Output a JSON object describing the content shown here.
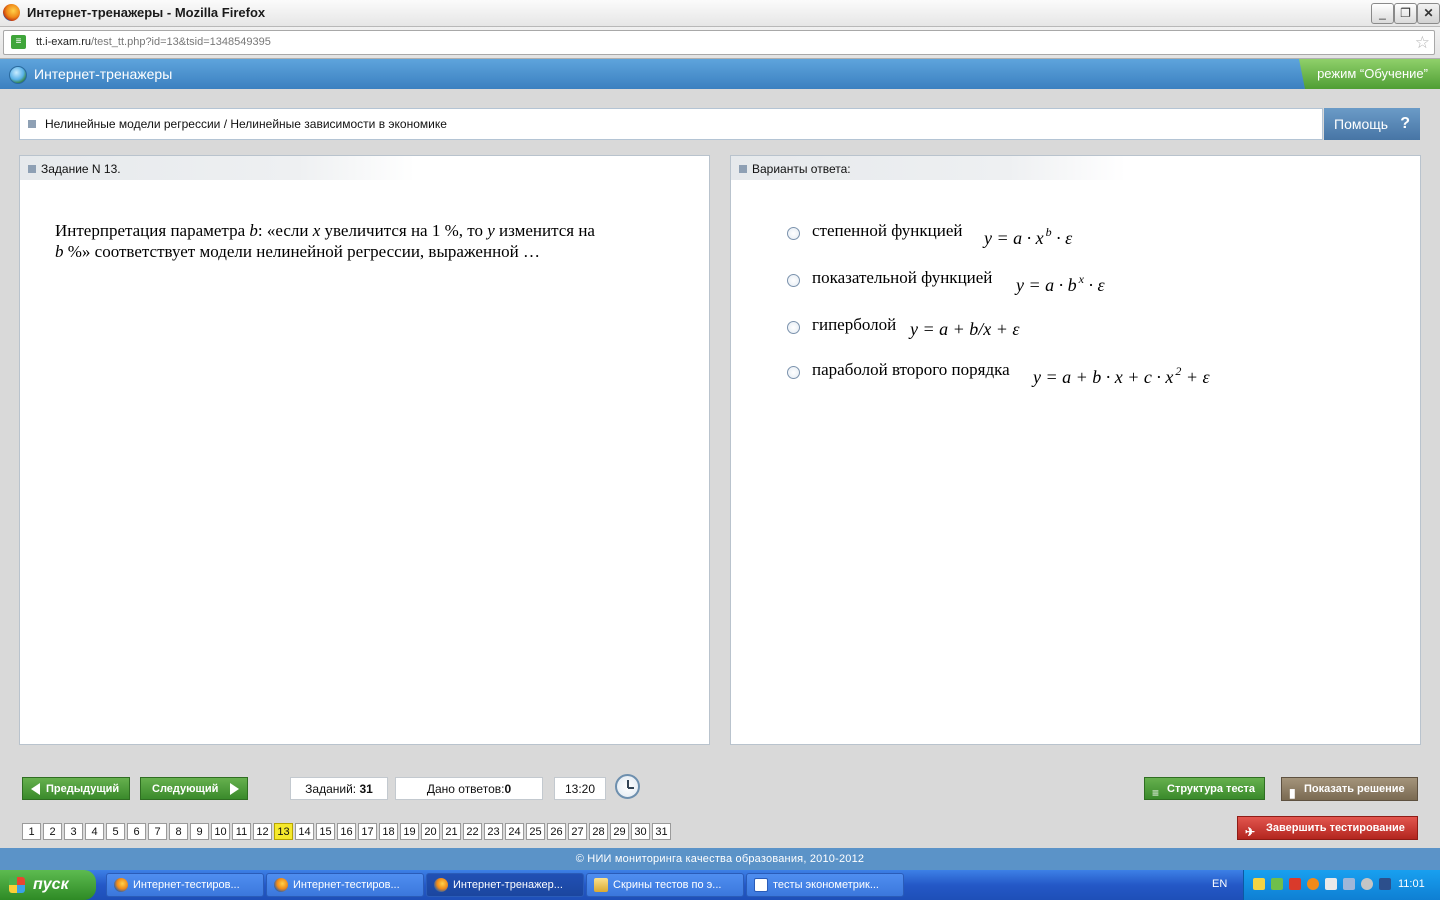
{
  "window": {
    "title": "Интернет-тренажеры - Mozilla Firefox",
    "min": "_",
    "max": "❐",
    "close": "✕"
  },
  "browser": {
    "url_host": "tt.i-exam.ru",
    "url_path": "/test_tt.php?id=13&tsid=1348549395",
    "bookmark_star": "☆"
  },
  "app": {
    "title": "Интернет-тренажеры",
    "mode": "режим “Обучение”"
  },
  "breadcrumb": "Нелинейные модели регрессии / Нелинейные зависимости в экономике",
  "help": {
    "label": "Помощь",
    "icon": "?"
  },
  "task": {
    "header": "Задание N 13.",
    "q1": "Интерпретация параметра ",
    "q_b": "b",
    "q2": ": «если ",
    "q_x": "x",
    "q3": " увеличится на 1 %, то ",
    "q_y": "y",
    "q4": " изменится на",
    "q_b2": "b",
    "q5": " %» соответствует модели нелинейной регрессии, выраженной …"
  },
  "answers": {
    "header": "Варианты ответа:",
    "options": [
      {
        "label": "степенной функцией",
        "f1": "y = a · x",
        "sup": "b",
        "f2": " · ε"
      },
      {
        "label": "показательной функцией",
        "f1": "y = a · b",
        "sup": "x",
        "f2": " · ε"
      },
      {
        "label": "гиперболой",
        "f1": "y = a + b/x + ε",
        "sup": "",
        "f2": ""
      },
      {
        "label": "параболой второго порядка",
        "f1": "y = a + b · x + c · x",
        "sup": "2",
        "f2": " + ε"
      }
    ]
  },
  "nav": {
    "prev": "Предыдущий",
    "next": "Следующий",
    "tasks_label": "Заданий:",
    "tasks_count": "31",
    "answered_label": "Дано ответов:",
    "answered_count": "0",
    "timer": "13:20",
    "structure": "Структура теста",
    "show_solution": "Показать решение",
    "finish": "Завершить тестирование"
  },
  "pages": [
    "1",
    "2",
    "3",
    "4",
    "5",
    "6",
    "7",
    "8",
    "9",
    "10",
    "11",
    "12",
    "13",
    "14",
    "15",
    "16",
    "17",
    "18",
    "19",
    "20",
    "21",
    "22",
    "23",
    "24",
    "25",
    "26",
    "27",
    "28",
    "29",
    "30",
    "31"
  ],
  "current_page": "13",
  "footer": "© НИИ мониторинга качества образования, 2010-2012",
  "taskbar": {
    "start": "пуск",
    "tasks": [
      {
        "label": "Интернет-тестиров...",
        "icon": "firefox-icon"
      },
      {
        "label": "Интернет-тестиров...",
        "icon": "firefox-icon"
      },
      {
        "label": "Интернет-тренажер...",
        "icon": "firefox-icon"
      },
      {
        "label": "Скрины тестов по э...",
        "icon": "folder-icon"
      },
      {
        "label": "тесты эконометрик...",
        "icon": "word-icon"
      }
    ],
    "lang": "EN",
    "time": "11:01"
  },
  "colors": {
    "header_blue": "#3b80c0",
    "accent_green": "#4f9e34",
    "finish_red": "#b3261f",
    "current_page": "#f5e92c"
  }
}
